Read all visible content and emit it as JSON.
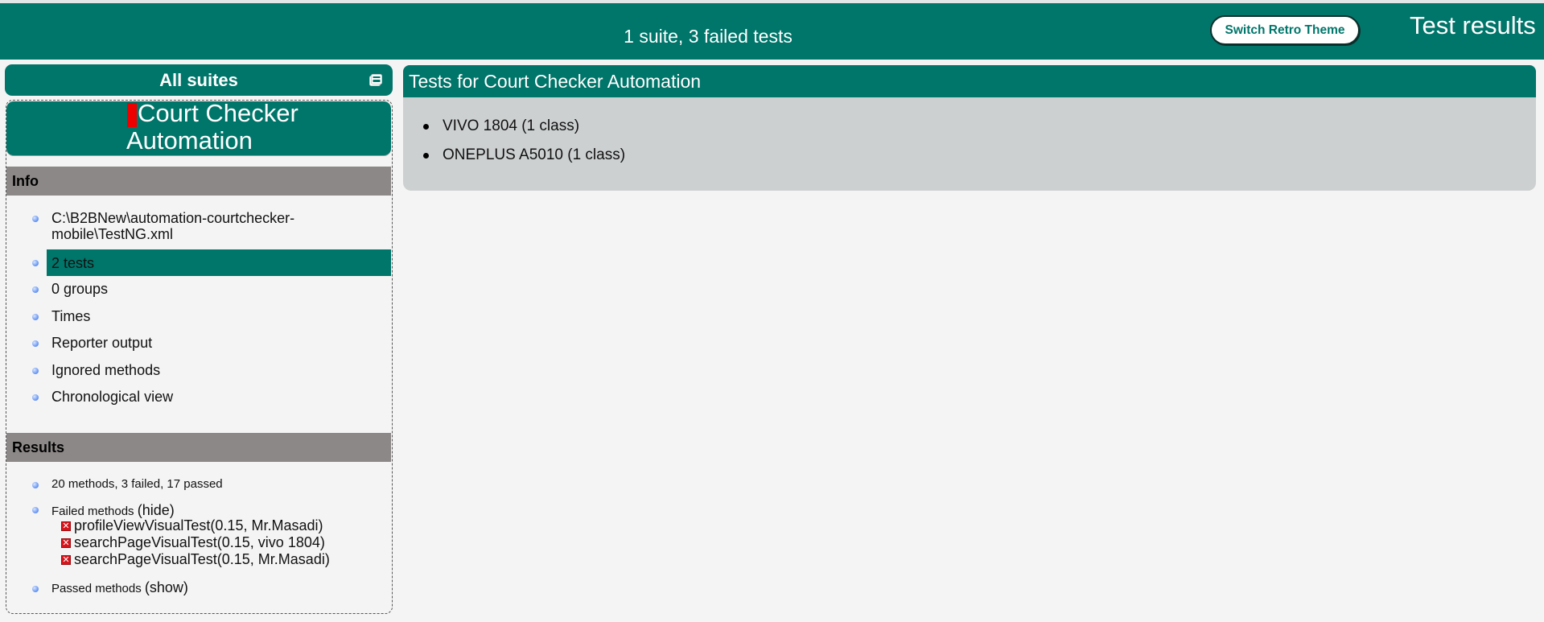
{
  "header": {
    "summary": "1 suite, 3 failed tests",
    "theme_button": "Switch Retro Theme",
    "title": "Test results"
  },
  "sidebar": {
    "all_suites_label": "All suites",
    "suite_name": "Court Checker Automation",
    "info_title": "Info",
    "info_items": [
      "C:\\B2BNew\\automation-courtchecker-mobile\\TestNG.xml",
      "2 tests",
      "0 groups",
      "Times",
      "Reporter output",
      "Ignored methods",
      "Chronological view"
    ],
    "results_title": "Results",
    "results_summary": "20 methods, 3 failed, 17 passed",
    "failed_label": "Failed methods",
    "failed_toggle": "(hide)",
    "failed_methods": [
      "profileViewVisualTest(0.15, Mr.Masadi)",
      "searchPageVisualTest(0.15, vivo 1804)",
      "searchPageVisualTest(0.15, Mr.Masadi)"
    ],
    "passed_label": "Passed methods",
    "passed_toggle": "(show)"
  },
  "main": {
    "title": "Tests for Court Checker Automation",
    "tests": [
      "VIVO 1804 (1 class)",
      "ONEPLUS A5010 (1 class)"
    ]
  },
  "colors": {
    "primary": "#00756a",
    "section_header": "#8c8887",
    "panel_bg": "#cdd0d1",
    "fail": "#ee0000"
  }
}
